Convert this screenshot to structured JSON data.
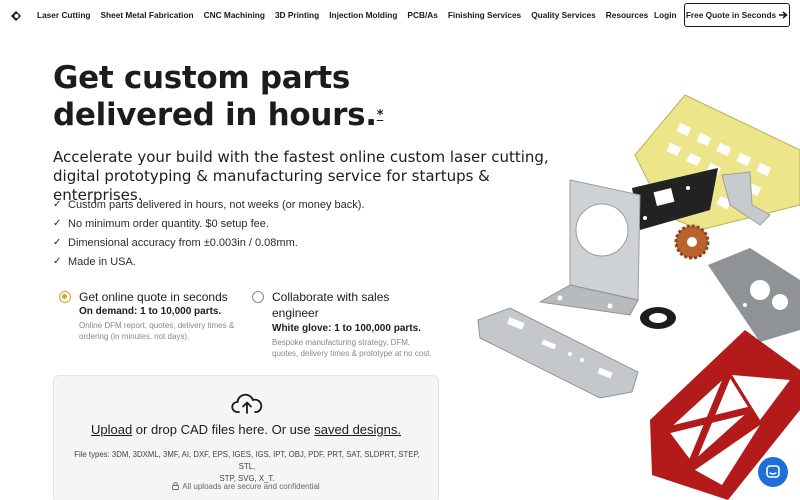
{
  "nav": {
    "links": [
      "Laser Cutting",
      "Sheet Metal Fabrication",
      "CNC Machining",
      "3D Printing",
      "Injection Molding",
      "PCB/As",
      "Finishing Services",
      "Quality Services",
      "Resources"
    ],
    "login": "Login",
    "quote_button": "Free Quote in Seconds"
  },
  "hero": {
    "title_line1": "Get custom parts",
    "title_line2": "delivered in hours.",
    "title_mark": "*",
    "subtitle": "Accelerate your build with the fastest online custom laser cutting, digital prototyping & manufacturing service for startups & enterprises."
  },
  "checklist": [
    "Custom parts delivered in hours, not weeks (or money back).",
    "No minimum order quantity. $0 setup fee.",
    "Dimensional accuracy from ±0.003in / 0.08mm.",
    "Made in USA."
  ],
  "options": {
    "online": {
      "title": "Get online quote in seconds",
      "subtitle": "On demand: 1 to 10,000 parts.",
      "desc_line1": "Online DFM report, quotes, delivery times &",
      "desc_line2": "ordering (in minutes, not days).",
      "selected": true
    },
    "sales": {
      "title_line1": "Collaborate with sales",
      "title_line2": "engineer",
      "subtitle": "White glove: 1 to 100,000 parts.",
      "desc_line1": "Bespoke manufacturing strategy, DFM,",
      "desc_line2": "quotes, delivery times & prototype at no cost.",
      "selected": false
    }
  },
  "upload": {
    "upload_link": "Upload",
    "middle_text": " or drop CAD files here. Or use ",
    "saved_link": "saved designs.",
    "filetypes_line1": "File types: 3DM, 3DXML, 3MF, AI, DXF, EPS, IGES, IGS, IPT, OBJ, PDF, PRT, SAT, SLDPRT, STEP, STL,",
    "filetypes_line2": "STP, SVG, X_T.",
    "secure_text": "All uploads are secure and confidential"
  },
  "colors": {
    "accent_radio": "#e0a32a",
    "chat_bubble": "#1f6fd8"
  }
}
